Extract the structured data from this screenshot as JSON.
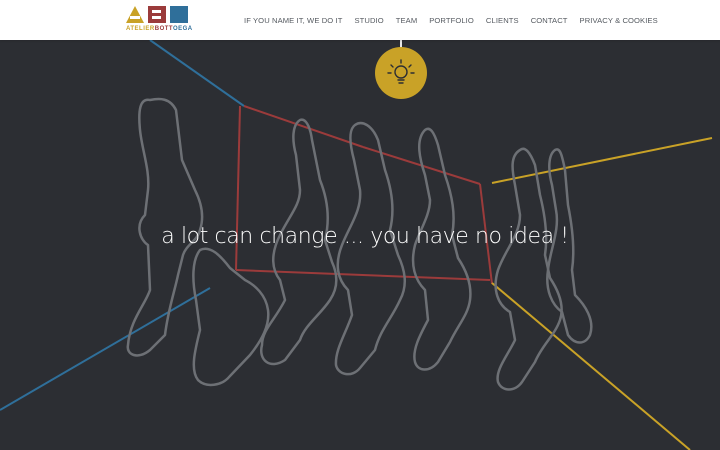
{
  "header": {
    "logo": {
      "icon": "atelier-bottega-logo-icon",
      "text_part1": "ATELIER",
      "text_part2": "BOTT",
      "text_part3": "OEGA"
    },
    "nav": [
      {
        "label": "IF YOU NAME IT, WE DO IT"
      },
      {
        "label": "STUDIO"
      },
      {
        "label": "TEAM"
      },
      {
        "label": "PORTFOLIO"
      },
      {
        "label": "CLIENTS"
      },
      {
        "label": "CONTACT"
      },
      {
        "label": "PRIVACY & COOKIES"
      }
    ]
  },
  "hero": {
    "tagline": "a lot can change ... you have no idea !",
    "bulb_icon": "lightbulb-icon",
    "illustration_icon": "upside-down-people-silhouette-icon"
  },
  "colors": {
    "background": "#2c2e33",
    "gold": "#c9a227",
    "red": "#9b3b3b",
    "blue": "#2f6f9a",
    "header_bg": "#ffffff"
  }
}
